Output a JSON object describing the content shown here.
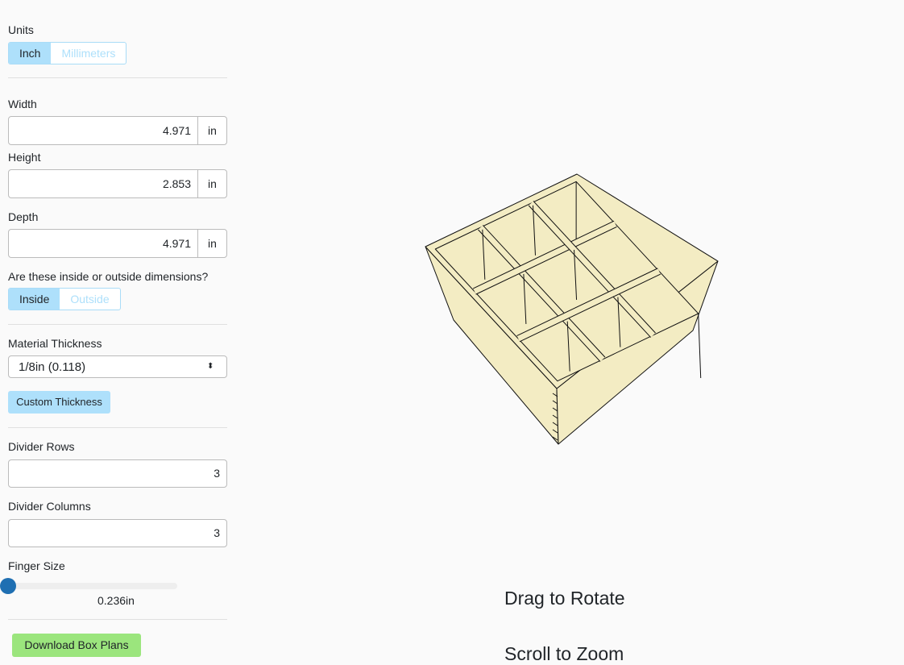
{
  "units": {
    "label": "Units",
    "options": [
      "Inch",
      "Millimeters"
    ],
    "selected": "Inch"
  },
  "width": {
    "label": "Width",
    "value": "4.971",
    "unit": "in"
  },
  "height": {
    "label": "Height",
    "value": "2.853",
    "unit": "in"
  },
  "depth": {
    "label": "Depth",
    "value": "4.971",
    "unit": "in"
  },
  "dimension_type": {
    "label": "Are these inside or outside dimensions?",
    "options": [
      "Inside",
      "Outside"
    ],
    "selected": "Inside"
  },
  "material": {
    "label": "Material Thickness",
    "selected": "1/8in (0.118)",
    "custom_label": "Custom Thickness"
  },
  "divider_rows": {
    "label": "Divider Rows",
    "value": "3"
  },
  "divider_columns": {
    "label": "Divider Columns",
    "value": "3"
  },
  "finger_size": {
    "label": "Finger Size",
    "value_text": "0.236in",
    "slider_fraction": 0
  },
  "download_label": "Download Box Plans",
  "viewer": {
    "hint1": "Drag to Rotate",
    "hint2": "Scroll to Zoom",
    "box_color": "#f3ecc3"
  },
  "colors": {
    "accent": "#aee0fb",
    "download": "#9be57d",
    "slider_thumb": "#1f6fb2"
  }
}
